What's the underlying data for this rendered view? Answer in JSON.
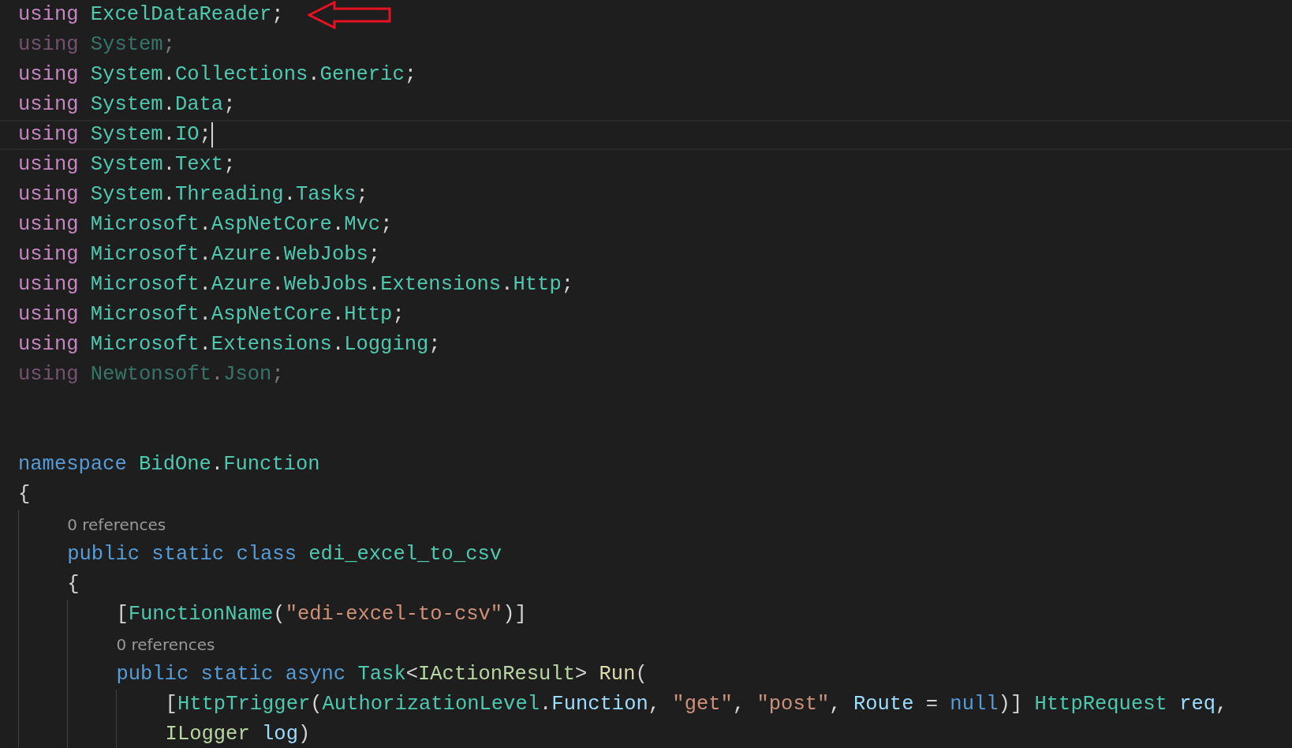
{
  "editor": {
    "lines": [
      {
        "kind": "code",
        "unused": false,
        "cursor": false,
        "annotated": true,
        "tokens": [
          {
            "t": "using",
            "kind": "kw"
          },
          {
            "t": " ExcelDataReader",
            "kind": "ns"
          },
          {
            "t": ";",
            "kind": "p"
          }
        ]
      },
      {
        "kind": "code",
        "unused": true,
        "cursor": false,
        "tokens": [
          {
            "t": "using",
            "kind": "kw"
          },
          {
            "t": " System",
            "kind": "ns"
          },
          {
            "t": ";",
            "kind": "p"
          }
        ]
      },
      {
        "kind": "code",
        "unused": false,
        "cursor": false,
        "tokens": [
          {
            "t": "using",
            "kind": "kw"
          },
          {
            "t": " System",
            "kind": "ns"
          },
          {
            "t": ".",
            "kind": "p"
          },
          {
            "t": "Collections",
            "kind": "ns"
          },
          {
            "t": ".",
            "kind": "p"
          },
          {
            "t": "Generic",
            "kind": "ns"
          },
          {
            "t": ";",
            "kind": "p"
          }
        ]
      },
      {
        "kind": "code",
        "unused": false,
        "cursor": false,
        "tokens": [
          {
            "t": "using",
            "kind": "kw"
          },
          {
            "t": " System",
            "kind": "ns"
          },
          {
            "t": ".",
            "kind": "p"
          },
          {
            "t": "Data",
            "kind": "ns"
          },
          {
            "t": ";",
            "kind": "p"
          }
        ]
      },
      {
        "kind": "code",
        "unused": false,
        "cursor": true,
        "tokens": [
          {
            "t": "using",
            "kind": "kw"
          },
          {
            "t": " System",
            "kind": "ns"
          },
          {
            "t": ".",
            "kind": "p"
          },
          {
            "t": "IO",
            "kind": "ns"
          },
          {
            "t": ";",
            "kind": "p"
          }
        ]
      },
      {
        "kind": "code",
        "unused": false,
        "cursor": false,
        "tokens": [
          {
            "t": "using",
            "kind": "kw"
          },
          {
            "t": " System",
            "kind": "ns"
          },
          {
            "t": ".",
            "kind": "p"
          },
          {
            "t": "Text",
            "kind": "ns"
          },
          {
            "t": ";",
            "kind": "p"
          }
        ]
      },
      {
        "kind": "code",
        "unused": false,
        "cursor": false,
        "tokens": [
          {
            "t": "using",
            "kind": "kw"
          },
          {
            "t": " System",
            "kind": "ns"
          },
          {
            "t": ".",
            "kind": "p"
          },
          {
            "t": "Threading",
            "kind": "ns"
          },
          {
            "t": ".",
            "kind": "p"
          },
          {
            "t": "Tasks",
            "kind": "ns"
          },
          {
            "t": ";",
            "kind": "p"
          }
        ]
      },
      {
        "kind": "code",
        "unused": false,
        "cursor": false,
        "tokens": [
          {
            "t": "using",
            "kind": "kw"
          },
          {
            "t": " Microsoft",
            "kind": "ns"
          },
          {
            "t": ".",
            "kind": "p"
          },
          {
            "t": "AspNetCore",
            "kind": "ns"
          },
          {
            "t": ".",
            "kind": "p"
          },
          {
            "t": "Mvc",
            "kind": "ns"
          },
          {
            "t": ";",
            "kind": "p"
          }
        ]
      },
      {
        "kind": "code",
        "unused": false,
        "cursor": false,
        "tokens": [
          {
            "t": "using",
            "kind": "kw"
          },
          {
            "t": " Microsoft",
            "kind": "ns"
          },
          {
            "t": ".",
            "kind": "p"
          },
          {
            "t": "Azure",
            "kind": "ns"
          },
          {
            "t": ".",
            "kind": "p"
          },
          {
            "t": "WebJobs",
            "kind": "ns"
          },
          {
            "t": ";",
            "kind": "p"
          }
        ]
      },
      {
        "kind": "code",
        "unused": false,
        "cursor": false,
        "tokens": [
          {
            "t": "using",
            "kind": "kw"
          },
          {
            "t": " Microsoft",
            "kind": "ns"
          },
          {
            "t": ".",
            "kind": "p"
          },
          {
            "t": "Azure",
            "kind": "ns"
          },
          {
            "t": ".",
            "kind": "p"
          },
          {
            "t": "WebJobs",
            "kind": "ns"
          },
          {
            "t": ".",
            "kind": "p"
          },
          {
            "t": "Extensions",
            "kind": "ns"
          },
          {
            "t": ".",
            "kind": "p"
          },
          {
            "t": "Http",
            "kind": "ns"
          },
          {
            "t": ";",
            "kind": "p"
          }
        ]
      },
      {
        "kind": "code",
        "unused": false,
        "cursor": false,
        "tokens": [
          {
            "t": "using",
            "kind": "kw"
          },
          {
            "t": " Microsoft",
            "kind": "ns"
          },
          {
            "t": ".",
            "kind": "p"
          },
          {
            "t": "AspNetCore",
            "kind": "ns"
          },
          {
            "t": ".",
            "kind": "p"
          },
          {
            "t": "Http",
            "kind": "ns"
          },
          {
            "t": ";",
            "kind": "p"
          }
        ]
      },
      {
        "kind": "code",
        "unused": false,
        "cursor": false,
        "tokens": [
          {
            "t": "using",
            "kind": "kw"
          },
          {
            "t": " Microsoft",
            "kind": "ns"
          },
          {
            "t": ".",
            "kind": "p"
          },
          {
            "t": "Extensions",
            "kind": "ns"
          },
          {
            "t": ".",
            "kind": "p"
          },
          {
            "t": "Logging",
            "kind": "ns"
          },
          {
            "t": ";",
            "kind": "p"
          }
        ]
      },
      {
        "kind": "code",
        "unused": true,
        "cursor": false,
        "tokens": [
          {
            "t": "using",
            "kind": "kw"
          },
          {
            "t": " Newtonsoft",
            "kind": "ns"
          },
          {
            "t": ".",
            "kind": "p"
          },
          {
            "t": "Json",
            "kind": "ns"
          },
          {
            "t": ";",
            "kind": "p"
          }
        ]
      },
      {
        "kind": "blank"
      },
      {
        "kind": "blank"
      },
      {
        "kind": "code",
        "unused": false,
        "cursor": false,
        "tokens": [
          {
            "t": "namespace",
            "kind": "kw2"
          },
          {
            "t": " BidOne",
            "kind": "ns"
          },
          {
            "t": ".",
            "kind": "p"
          },
          {
            "t": "Function",
            "kind": "ns"
          }
        ]
      },
      {
        "kind": "code",
        "unused": false,
        "cursor": false,
        "tokens": [
          {
            "t": "{",
            "kind": "p"
          }
        ],
        "children": [
          {
            "kind": "codelens",
            "text": "0 references"
          },
          {
            "kind": "code",
            "unused": false,
            "cursor": false,
            "tokens": [
              {
                "t": "public",
                "kind": "kw2"
              },
              {
                "t": " static",
                "kind": "kw2"
              },
              {
                "t": " class",
                "kind": "kw2"
              },
              {
                "t": " edi_excel_to_csv",
                "kind": "ns"
              }
            ]
          },
          {
            "kind": "code",
            "unused": false,
            "cursor": false,
            "tokens": [
              {
                "t": "{",
                "kind": "p"
              }
            ],
            "children": [
              {
                "kind": "code",
                "unused": false,
                "cursor": false,
                "tokens": [
                  {
                    "t": "[",
                    "kind": "p"
                  },
                  {
                    "t": "FunctionName",
                    "kind": "ns"
                  },
                  {
                    "t": "(",
                    "kind": "p"
                  },
                  {
                    "t": "\"edi-excel-to-csv\"",
                    "kind": "str"
                  },
                  {
                    "t": ")]",
                    "kind": "p"
                  }
                ]
              },
              {
                "kind": "codelens",
                "text": "0 references"
              },
              {
                "kind": "code",
                "unused": false,
                "cursor": false,
                "tokens": [
                  {
                    "t": "public",
                    "kind": "kw2"
                  },
                  {
                    "t": " static",
                    "kind": "kw2"
                  },
                  {
                    "t": " async",
                    "kind": "kw2"
                  },
                  {
                    "t": " Task",
                    "kind": "ns"
                  },
                  {
                    "t": "<",
                    "kind": "p"
                  },
                  {
                    "t": "IActionResult",
                    "kind": "iface"
                  },
                  {
                    "t": "> ",
                    "kind": "p"
                  },
                  {
                    "t": "Run",
                    "kind": "fn"
                  },
                  {
                    "t": "(",
                    "kind": "p"
                  }
                ],
                "children": [
                  {
                    "kind": "code",
                    "unused": false,
                    "cursor": false,
                    "tokens": [
                      {
                        "t": "[",
                        "kind": "p"
                      },
                      {
                        "t": "HttpTrigger",
                        "kind": "ns"
                      },
                      {
                        "t": "(",
                        "kind": "p"
                      },
                      {
                        "t": "AuthorizationLevel",
                        "kind": "ns"
                      },
                      {
                        "t": ".",
                        "kind": "p"
                      },
                      {
                        "t": "Function",
                        "kind": "var"
                      },
                      {
                        "t": ", ",
                        "kind": "p"
                      },
                      {
                        "t": "\"get\"",
                        "kind": "str"
                      },
                      {
                        "t": ", ",
                        "kind": "p"
                      },
                      {
                        "t": "\"post\"",
                        "kind": "str"
                      },
                      {
                        "t": ", ",
                        "kind": "p"
                      },
                      {
                        "t": "Route",
                        "kind": "var"
                      },
                      {
                        "t": " = ",
                        "kind": "p"
                      },
                      {
                        "t": "null",
                        "kind": "kw2"
                      },
                      {
                        "t": ")] ",
                        "kind": "p"
                      },
                      {
                        "t": "HttpRequest",
                        "kind": "ns"
                      },
                      {
                        "t": " req",
                        "kind": "var"
                      },
                      {
                        "t": ",",
                        "kind": "p"
                      }
                    ]
                  },
                  {
                    "kind": "code",
                    "unused": false,
                    "cursor": false,
                    "tokens": [
                      {
                        "t": "ILogger",
                        "kind": "iface"
                      },
                      {
                        "t": " log",
                        "kind": "var"
                      },
                      {
                        "t": ")",
                        "kind": "p"
                      }
                    ]
                  }
                ]
              }
            ]
          }
        ]
      }
    ]
  }
}
